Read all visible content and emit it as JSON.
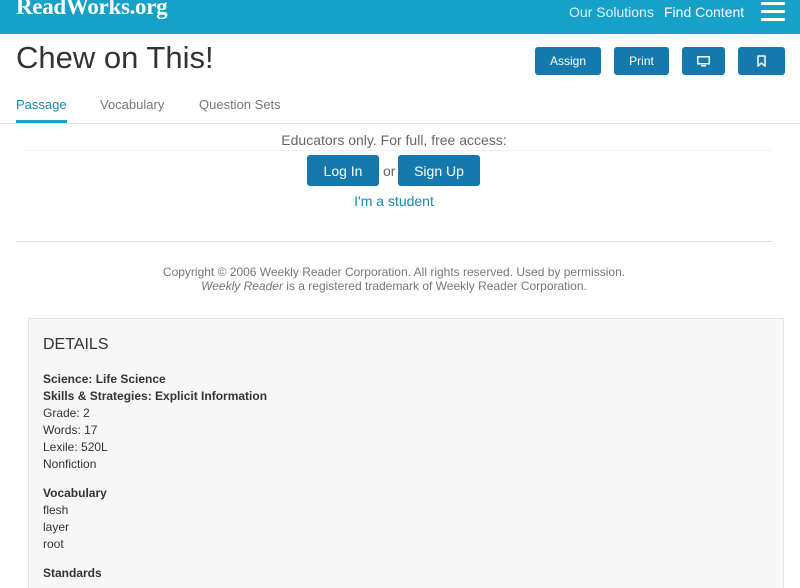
{
  "header": {
    "logo": "ReadWorks.org",
    "nav": [
      "Our Solutions",
      "Find Content"
    ],
    "menu_icon": "hamburger-icon"
  },
  "page": {
    "title": "Chew on This!",
    "actions": {
      "assign": "Assign",
      "print": "Print",
      "present_icon": "monitor-icon",
      "bookmark_icon": "bookmark-icon"
    }
  },
  "tabs": [
    {
      "label": "Passage",
      "active": true
    },
    {
      "label": "Vocabulary",
      "active": false
    },
    {
      "label": "Question Sets",
      "active": false
    }
  ],
  "access": {
    "message": "Educators only. For full, free access:",
    "login": "Log In",
    "or": "or",
    "signup": "Sign Up",
    "student": "I'm a student"
  },
  "copyright": {
    "line1": "Copyright © 2006 Weekly Reader Corporation. All rights reserved. Used by permission.",
    "line2_italic": "Weekly Reader",
    "line2_rest": " is a registered trademark of Weekly Reader Corporation."
  },
  "details": {
    "heading": "DETAILS",
    "subject": "Science: Life Science",
    "skills": "Skills & Strategies: Explicit Information",
    "grade": "Grade: 2",
    "words": "Words: 17",
    "lexile": "Lexile: 520L",
    "genre": "Nonfiction",
    "vocab_heading": "Vocabulary",
    "vocab_words": [
      "flesh",
      "layer",
      "root"
    ],
    "standards_heading": "Standards"
  },
  "colors": {
    "brand": "#16a1c9",
    "button": "#1479ad",
    "link": "#1789b5"
  }
}
